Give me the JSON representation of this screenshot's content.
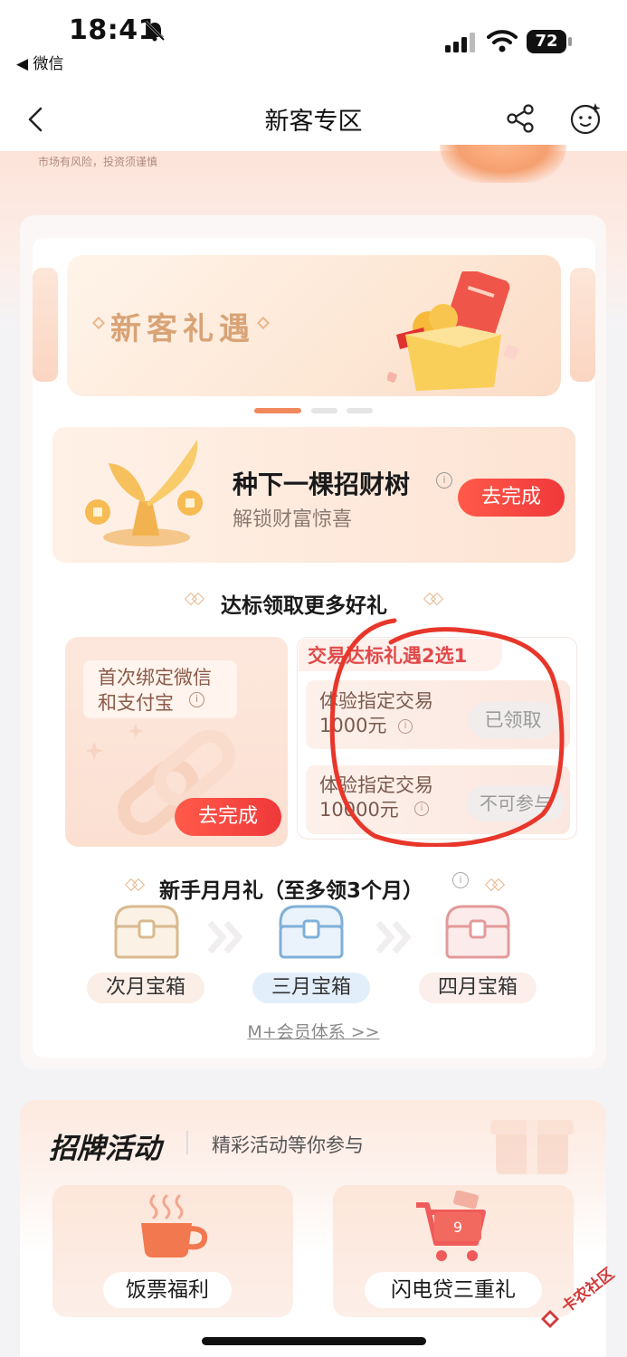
{
  "status_bar": {
    "time": "18:41",
    "back_app": "◀ 微信",
    "battery": "72"
  },
  "nav": {
    "title": "新客专区"
  },
  "header": {
    "risk_notice": "市场有风险，投资须谨慎"
  },
  "banner": {
    "title": "新客礼遇",
    "active_dot": 0,
    "dot_count": 3
  },
  "tree_task": {
    "title": "种下一棵招财树",
    "subtitle": "解锁财富惊喜",
    "button": "去完成"
  },
  "reward_section": {
    "title": "达标领取更多好礼",
    "bind_card": {
      "line1": "首次绑定微信",
      "line2": "和支付宝",
      "button": "去完成"
    },
    "trade_card": {
      "header": "交易达标礼遇2选1",
      "rows": [
        {
          "line1": "体验指定交易",
          "line2": "1000元",
          "status": "已领取"
        },
        {
          "line1": "体验指定交易",
          "line2": "10000元",
          "status": "不可参与"
        }
      ]
    }
  },
  "monthly": {
    "title": "新手月月礼（至多领3个月）",
    "chests": [
      {
        "label": "次月宝箱",
        "color": "#d9b98e",
        "label_bg": "#fbeee6"
      },
      {
        "label": "三月宝箱",
        "color": "#7fb0d8",
        "label_bg": "#e3eefb"
      },
      {
        "label": "四月宝箱",
        "color": "#e39a9a",
        "label_bg": "#fbeeeb"
      }
    ],
    "link": "M+会员体系 >>"
  },
  "activities": {
    "title": "招牌活动",
    "subtitle": "精彩活动等你参与",
    "items": [
      {
        "label": "饭票福利",
        "icon": "coffee-cup-icon"
      },
      {
        "label": "闪电贷三重礼",
        "icon": "shopping-cart-icon"
      }
    ]
  },
  "watermark": {
    "text": "卡农社区"
  },
  "colors": {
    "accent_red": "#f0383a",
    "gold": "#d9a376",
    "annotation": "#e8362a"
  }
}
